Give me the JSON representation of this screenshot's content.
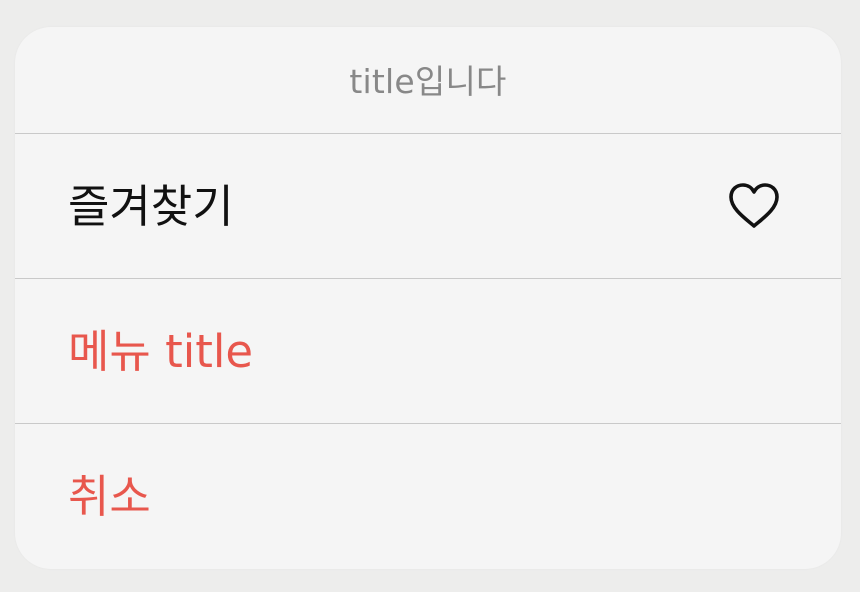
{
  "sheet": {
    "title": "title입니다",
    "items": [
      {
        "label": "즐겨찾기",
        "icon": "heart-outline-icon",
        "color": "#111111"
      },
      {
        "label": "메뉴 title",
        "color": "#e8574d"
      },
      {
        "label": "취소",
        "color": "#e8574d"
      }
    ]
  },
  "colors": {
    "background": "#ededec",
    "sheet": "#f5f5f5",
    "divider": "#c9c9c9",
    "title_text": "#888888",
    "destructive": "#e8574d"
  }
}
